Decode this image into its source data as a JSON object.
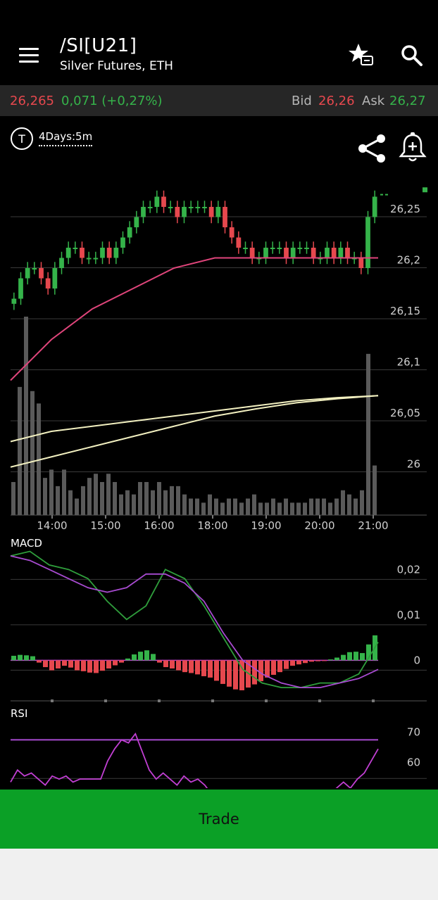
{
  "header": {
    "symbol": "/SI[U21]",
    "description": "Silver Futures, ETH"
  },
  "quote": {
    "last": "26,265",
    "change": "0,071 (+0,27%)",
    "bid_label": "Bid",
    "bid": "26,26",
    "ask_label": "Ask",
    "ask": "26,27"
  },
  "toolbar": {
    "timeframe_icon_letter": "T",
    "timeframe": "4Days:5m"
  },
  "price_axis": [
    "26,25",
    "26,2",
    "26,15",
    "26,1",
    "26,05",
    "26"
  ],
  "time_axis": [
    "14:00",
    "15:00",
    "16:00",
    "18:00",
    "19:00",
    "20:00",
    "21:00"
  ],
  "macd": {
    "label": "MACD",
    "axis": [
      "0,02",
      "0,01",
      "0"
    ]
  },
  "rsi": {
    "label": "RSI",
    "axis": [
      "70",
      "60"
    ]
  },
  "trade_button": "Trade",
  "colors": {
    "up": "#35b34a",
    "down": "#e6484e",
    "accent": "#0ba026",
    "ma_pink": "#e0457b",
    "ma_cream": "#f2f0c0",
    "macd_line": "#2f9e3c",
    "signal_line": "#a84bd1",
    "rsi_line": "#c13fd3"
  },
  "icons": [
    "menu-icon",
    "favorite-list-icon",
    "search-icon",
    "timeframe-icon",
    "share-icon",
    "add-alert-icon"
  ],
  "chart_data": [
    {
      "type": "line",
      "title": "",
      "ylim": [
        25.97,
        26.27
      ],
      "x_ticks": [
        "14:00",
        "15:00",
        "16:00",
        "18:00",
        "19:00",
        "20:00",
        "21:00"
      ],
      "candles_close": [
        26.16,
        26.18,
        26.19,
        26.19,
        26.18,
        26.17,
        26.19,
        26.2,
        26.21,
        26.21,
        26.2,
        26.2,
        26.2,
        26.21,
        26.2,
        26.21,
        26.22,
        26.23,
        26.24,
        26.25,
        26.25,
        26.26,
        26.25,
        26.25,
        26.24,
        26.25,
        26.25,
        26.25,
        26.25,
        26.24,
        26.25,
        26.23,
        26.22,
        26.21,
        26.21,
        26.2,
        26.2,
        26.21,
        26.21,
        26.21,
        26.2,
        26.21,
        26.21,
        26.21,
        26.2,
        26.2,
        26.21,
        26.2,
        26.21,
        26.2,
        26.2,
        26.19,
        26.24,
        26.26
      ],
      "series": [
        {
          "values": [
            26.08,
            26.12,
            26.15,
            26.17,
            26.19,
            26.2,
            26.2,
            26.2,
            26.2,
            26.2
          ]
        },
        {
          "values": [
            26.02,
            26.03,
            26.035,
            26.04,
            26.045,
            26.05,
            26.055,
            26.06,
            26.063,
            26.065
          ]
        },
        {
          "values": [
            25.995,
            26.005,
            26.015,
            26.025,
            26.035,
            26.045,
            26.052,
            26.058,
            26.062,
            26.065
          ]
        }
      ],
      "volume": [
        8,
        31,
        48,
        30,
        27,
        9,
        11,
        7,
        11,
        6,
        4,
        7,
        9,
        10,
        8,
        10,
        8,
        5,
        6,
        5,
        8,
        8,
        6,
        8,
        6,
        7,
        7,
        5,
        4,
        4,
        3,
        5,
        4,
        3,
        4,
        4,
        3,
        4,
        5,
        3,
        3,
        4,
        3,
        4,
        3,
        3,
        3,
        4,
        4,
        4,
        3,
        4,
        6,
        5,
        4,
        6,
        39,
        12
      ]
    },
    {
      "type": "bar",
      "title": "MACD",
      "ylim": [
        -0.008,
        0.023
      ],
      "histogram": [
        0.001,
        0.0012,
        0.0011,
        0.0009,
        -0.0005,
        -0.0015,
        -0.0022,
        -0.0018,
        -0.0012,
        -0.0016,
        -0.0022,
        -0.0024,
        -0.0027,
        -0.0028,
        -0.0023,
        -0.0018,
        -0.0011,
        -0.0005,
        0.0004,
        0.0013,
        0.0019,
        0.0022,
        0.0014,
        -0.0005,
        -0.0015,
        -0.0018,
        -0.0022,
        -0.0026,
        -0.0028,
        -0.0031,
        -0.0035,
        -0.0038,
        -0.0045,
        -0.0052,
        -0.0058,
        -0.0064,
        -0.0066,
        -0.006,
        -0.0053,
        -0.0046,
        -0.0038,
        -0.0032,
        -0.0026,
        -0.0019,
        -0.0012,
        -0.0009,
        -0.0006,
        -0.0003,
        -0.0002,
        -0.0001,
        0.0002,
        0.0006,
        0.0012,
        0.0018,
        0.0019,
        0.0016,
        0.0035,
        0.0055
      ],
      "series": [
        {
          "values": [
            0.023,
            0.024,
            0.021,
            0.02,
            0.018,
            0.013,
            0.009,
            0.012,
            0.02,
            0.018,
            0.012,
            0.005,
            -0.002,
            -0.005,
            -0.006,
            -0.006,
            -0.005,
            -0.005,
            -0.003,
            0.004
          ]
        },
        {
          "values": [
            0.023,
            0.022,
            0.02,
            0.018,
            0.016,
            0.015,
            0.016,
            0.019,
            0.019,
            0.017,
            0.013,
            0.006,
            0.0,
            -0.003,
            -0.005,
            -0.006,
            -0.006,
            -0.005,
            -0.004,
            -0.002
          ]
        }
      ]
    },
    {
      "type": "line",
      "title": "RSI",
      "ylim": [
        54,
        75
      ],
      "levels": [
        70,
        60
      ],
      "series": [
        {
          "values": [
            56,
            60,
            58,
            59,
            57,
            55,
            58,
            57,
            58,
            56,
            57,
            57,
            57,
            57,
            63,
            67,
            70,
            69,
            72,
            66,
            60,
            57,
            59,
            57,
            55,
            58,
            56,
            57,
            55,
            52,
            50,
            51,
            49,
            48,
            47,
            48,
            47,
            46,
            47,
            46,
            45,
            47,
            46,
            48,
            49,
            50,
            52,
            54,
            56,
            54,
            57,
            59,
            63,
            67
          ]
        }
      ]
    }
  ]
}
